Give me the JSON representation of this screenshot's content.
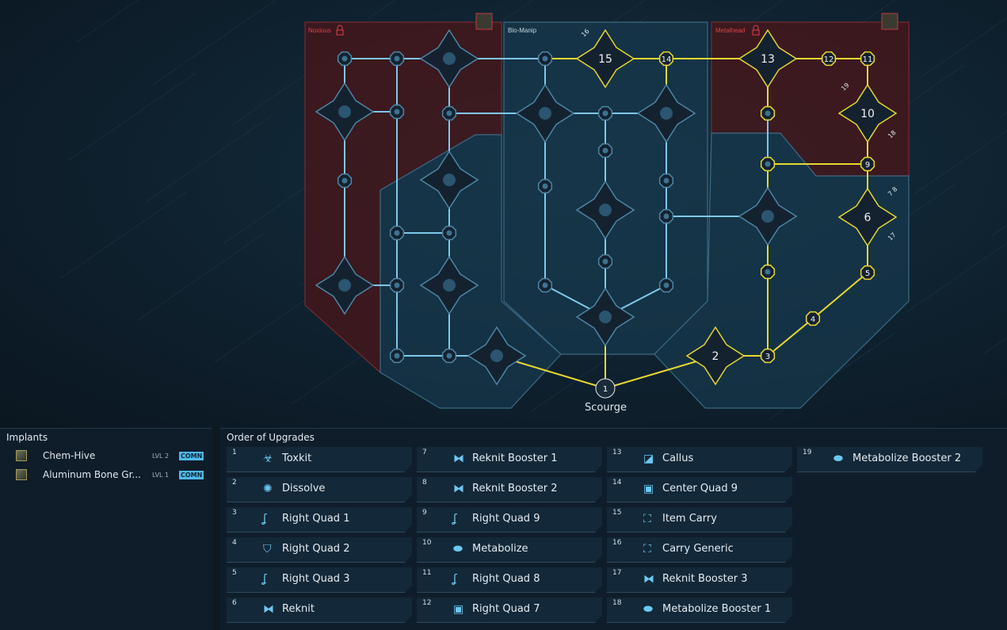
{
  "tree": {
    "regions": [
      {
        "name": "Noxious",
        "locked": true,
        "color": "#e04048"
      },
      {
        "name": "Bio-Manip",
        "locked": false,
        "color": "#c8d8e0"
      },
      {
        "name": "Metalhead",
        "locked": true,
        "color": "#e04048"
      }
    ],
    "root_label": "Scourge",
    "node_numbers": [
      "15",
      "14",
      "13",
      "12",
      "11",
      "10",
      "9",
      "6",
      "5",
      "4",
      "3",
      "2",
      "1"
    ],
    "side_labels": [
      "16",
      "19",
      "18",
      "7 8",
      "17"
    ],
    "colors": {
      "path": "#e8d830",
      "link": "#7fc8ea",
      "red_zone": "#4a1518",
      "blue_zone": "#17384c"
    }
  },
  "implants": {
    "title": "Implants",
    "items": [
      {
        "name": "Chem-Hive",
        "level": "LVL 2",
        "rarity": "COMN"
      },
      {
        "name": "Aluminum Bone Gr...",
        "level": "LVL 1",
        "rarity": "COMN"
      }
    ]
  },
  "order": {
    "title": "Order of Upgrades",
    "items": [
      {
        "n": "1",
        "label": "Toxkit",
        "icon": "biohazard-icon"
      },
      {
        "n": "2",
        "label": "Dissolve",
        "icon": "dissolve-icon"
      },
      {
        "n": "3",
        "label": "Right Quad 1",
        "icon": "muscle-icon"
      },
      {
        "n": "4",
        "label": "Right Quad 2",
        "icon": "shield-arm-icon"
      },
      {
        "n": "5",
        "label": "Right Quad 3",
        "icon": "muscle-icon"
      },
      {
        "n": "6",
        "label": "Reknit",
        "icon": "dna-icon"
      },
      {
        "n": "7",
        "label": "Reknit Booster 1",
        "icon": "dna-icon"
      },
      {
        "n": "8",
        "label": "Reknit Booster 2",
        "icon": "dna-icon"
      },
      {
        "n": "9",
        "label": "Right Quad 9",
        "icon": "muscle-icon"
      },
      {
        "n": "10",
        "label": "Metabolize",
        "icon": "pill-icon"
      },
      {
        "n": "11",
        "label": "Right Quad 8",
        "icon": "muscle-icon"
      },
      {
        "n": "12",
        "label": "Right Quad 7",
        "icon": "chip-icon"
      },
      {
        "n": "13",
        "label": "Callus",
        "icon": "callus-icon"
      },
      {
        "n": "14",
        "label": "Center Quad 9",
        "icon": "chip-icon"
      },
      {
        "n": "15",
        "label": "Item Carry",
        "icon": "carry-icon"
      },
      {
        "n": "16",
        "label": "Carry Generic",
        "icon": "carry-icon"
      },
      {
        "n": "17",
        "label": "Reknit Booster 3",
        "icon": "dna-icon"
      },
      {
        "n": "18",
        "label": "Metabolize Booster 1",
        "icon": "pill-icon"
      },
      {
        "n": "19",
        "label": "Metabolize Booster 2",
        "icon": "pill-icon"
      }
    ]
  }
}
